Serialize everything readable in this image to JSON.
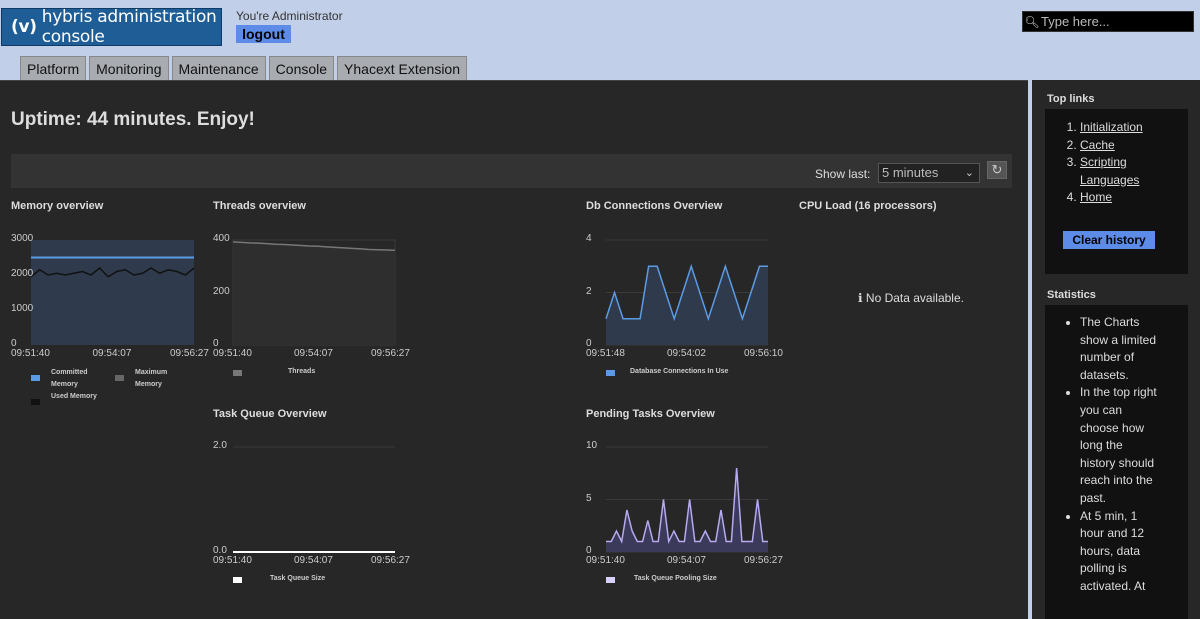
{
  "header": {
    "logo_mark": "(v)",
    "logo_text": "hybris administration console",
    "user_text": "You're Administrator",
    "logout_label": "logout",
    "search_placeholder": "Type here..."
  },
  "tabs": [
    {
      "label": "Platform"
    },
    {
      "label": "Monitoring"
    },
    {
      "label": "Maintenance"
    },
    {
      "label": "Console"
    },
    {
      "label": "Yhacext Extension"
    }
  ],
  "main": {
    "uptime": "Uptime: 44 minutes. Enjoy!",
    "show_last_label": "Show last:",
    "show_last_value": "5 minutes",
    "no_data": "No Data available."
  },
  "sidebar": {
    "top_links_title": "Top links",
    "links": [
      "Initialization",
      "Cache",
      "Scripting Languages",
      "Home"
    ],
    "clear_history_label": "Clear history",
    "statistics_title": "Statistics",
    "statistics_items": [
      "The Charts show a limited number of datasets.",
      "In the top right you can choose how long the history should reach into the past.",
      "At 5 min, 1 hour and 12 hours, data polling is activated. At"
    ]
  },
  "colors": {
    "accent": "#5c8ce8",
    "logo_bg": "#1e5d96",
    "panel_bg": "#272727",
    "page_bg": "#c2cfe8"
  },
  "chart_data": [
    {
      "type": "area",
      "title": "Memory overview",
      "x": [
        "09:51:40",
        "09:54:07",
        "09:56:27"
      ],
      "ylim": [
        0,
        3000
      ],
      "yticks": [
        "3000",
        "2000",
        "1000",
        "0"
      ],
      "series": [
        {
          "name": "Committed Memory",
          "values": [
            2500,
            2500,
            2500,
            2500,
            2500,
            2500,
            2500,
            2500,
            2500,
            2500,
            2500,
            2500,
            2500,
            2500,
            2500,
            2500,
            2500,
            2500,
            2500,
            2500
          ]
        },
        {
          "name": "Maximum Memory",
          "values": [
            2000,
            2000,
            2000,
            2000,
            2000,
            2000,
            2000,
            2000,
            2000,
            2000,
            2000,
            2000,
            2000,
            2000,
            2000,
            2000,
            2000,
            2000,
            2000,
            2000
          ]
        },
        {
          "name": "Used Memory",
          "values": [
            1950,
            2150,
            2000,
            2050,
            2000,
            2050,
            2100,
            2000,
            2200,
            1950,
            2100,
            2150,
            2000,
            2050,
            2200,
            2050,
            2150,
            2100,
            2000,
            2200
          ]
        }
      ]
    },
    {
      "type": "area",
      "title": "Threads overview",
      "x": [
        "09:51:40",
        "09:54:07",
        "09:56:27"
      ],
      "ylim": [
        0,
        400
      ],
      "yticks": [
        "400",
        "200",
        "0"
      ],
      "series": [
        {
          "name": "Threads",
          "values": [
            393,
            391,
            389,
            388,
            386,
            384,
            383,
            381,
            379,
            377,
            376,
            374,
            372,
            370,
            368,
            366,
            364,
            363,
            362,
            361
          ]
        }
      ]
    },
    {
      "type": "area",
      "title": "Db Connections Overview",
      "x": [
        "09:51:48",
        "09:54:02",
        "09:56:10"
      ],
      "ylim": [
        0,
        4
      ],
      "yticks": [
        "4",
        "2",
        "0"
      ],
      "series": [
        {
          "name": "Database Connections In Use",
          "values": [
            1,
            2,
            1,
            1,
            1,
            3,
            3,
            2,
            1,
            2,
            3,
            2,
            1,
            2,
            3,
            2,
            1,
            2,
            3,
            3
          ]
        }
      ]
    },
    {
      "type": "line",
      "title": "CPU Load (16 processors)",
      "series": []
    },
    {
      "type": "line",
      "title": "Task Queue Overview",
      "x": [
        "09:51:40",
        "09:54:07",
        "09:56:27"
      ],
      "ylim": [
        0,
        2.0
      ],
      "yticks": [
        "2.0",
        "0.0"
      ],
      "series": [
        {
          "name": "Task Queue Size",
          "values": [
            0,
            0,
            0,
            0,
            0,
            0,
            0,
            0,
            0,
            0,
            0,
            0,
            0,
            0,
            0,
            0,
            0,
            0,
            0,
            0
          ]
        }
      ]
    },
    {
      "type": "area",
      "title": "Pending Tasks Overview",
      "x": [
        "09:51:40",
        "09:54:07",
        "09:56:27"
      ],
      "ylim": [
        0,
        10
      ],
      "yticks": [
        "10",
        "5",
        "0"
      ],
      "series": [
        {
          "name": "Task Queue Pooling Size",
          "values": [
            1,
            1,
            2,
            1,
            4,
            2,
            1,
            1,
            3,
            1,
            1,
            5,
            1,
            2,
            1,
            1,
            5,
            1,
            1,
            2,
            1,
            1,
            4,
            1,
            1,
            8,
            1,
            1,
            1,
            5,
            1,
            1
          ]
        }
      ]
    }
  ]
}
